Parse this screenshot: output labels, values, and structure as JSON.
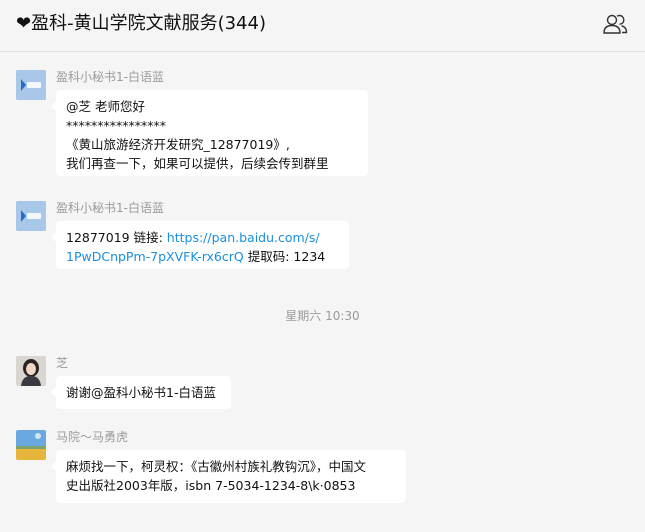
{
  "header": {
    "title": "❤盈科-黄山学院文献服务(344)",
    "members_icon": "group-members-icon"
  },
  "messages": [
    {
      "sender": "盈科小秘书1-白语蓝",
      "avatar": "yingke-logo-avatar",
      "lines": [
        "@芝 老师您好",
        "****************",
        "《黄山旅游经济开发研究_12877019》,",
        "我们再查一下，如果可以提供，后续会传到群里"
      ]
    },
    {
      "sender": "盈科小秘书1-白语蓝",
      "avatar": "yingke-logo-avatar",
      "line1_prefix": "12877019 链接: ",
      "link_part1": "https://pan.baidu.com/s/",
      "link_part2": "1PwDCnpPm-7pXVFK-rx6crQ",
      "line2_suffix": " 提取码: 1234"
    },
    {
      "timestamp": "星期六 10:30"
    },
    {
      "sender": "芝",
      "avatar": "woman-photo-avatar",
      "lines": [
        "谢谢@盈科小秘书1-白语蓝"
      ]
    },
    {
      "sender": "马院～马勇虎",
      "avatar": "landscape-photo-avatar",
      "lines": [
        "麻烦找一下，柯灵权：《古徽州村族礼教钩沉》，中国文",
        "史出版社2003年版，isbn 7-5034-1234-8\\k·0853"
      ]
    }
  ],
  "colors": {
    "background": "#f5f5f5",
    "bubble": "#ffffff",
    "link": "#1a8fe0",
    "meta_text": "#9b9b9b"
  }
}
